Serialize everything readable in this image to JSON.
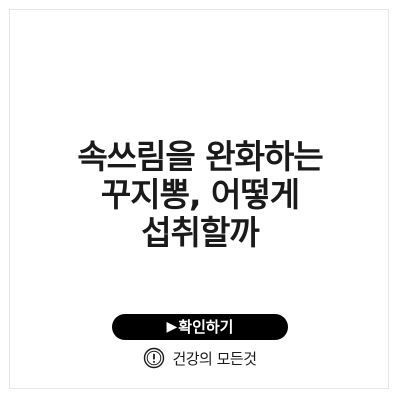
{
  "title": {
    "line1": "속쓰림을 완화하는",
    "line2": "꾸지뽕, 어떻게",
    "line3": "섭취할까"
  },
  "cta": {
    "arrow": "▶",
    "label": "확인하기"
  },
  "brand": {
    "icon": "exclamation-circle-icon",
    "name": "건강의 모든것"
  }
}
